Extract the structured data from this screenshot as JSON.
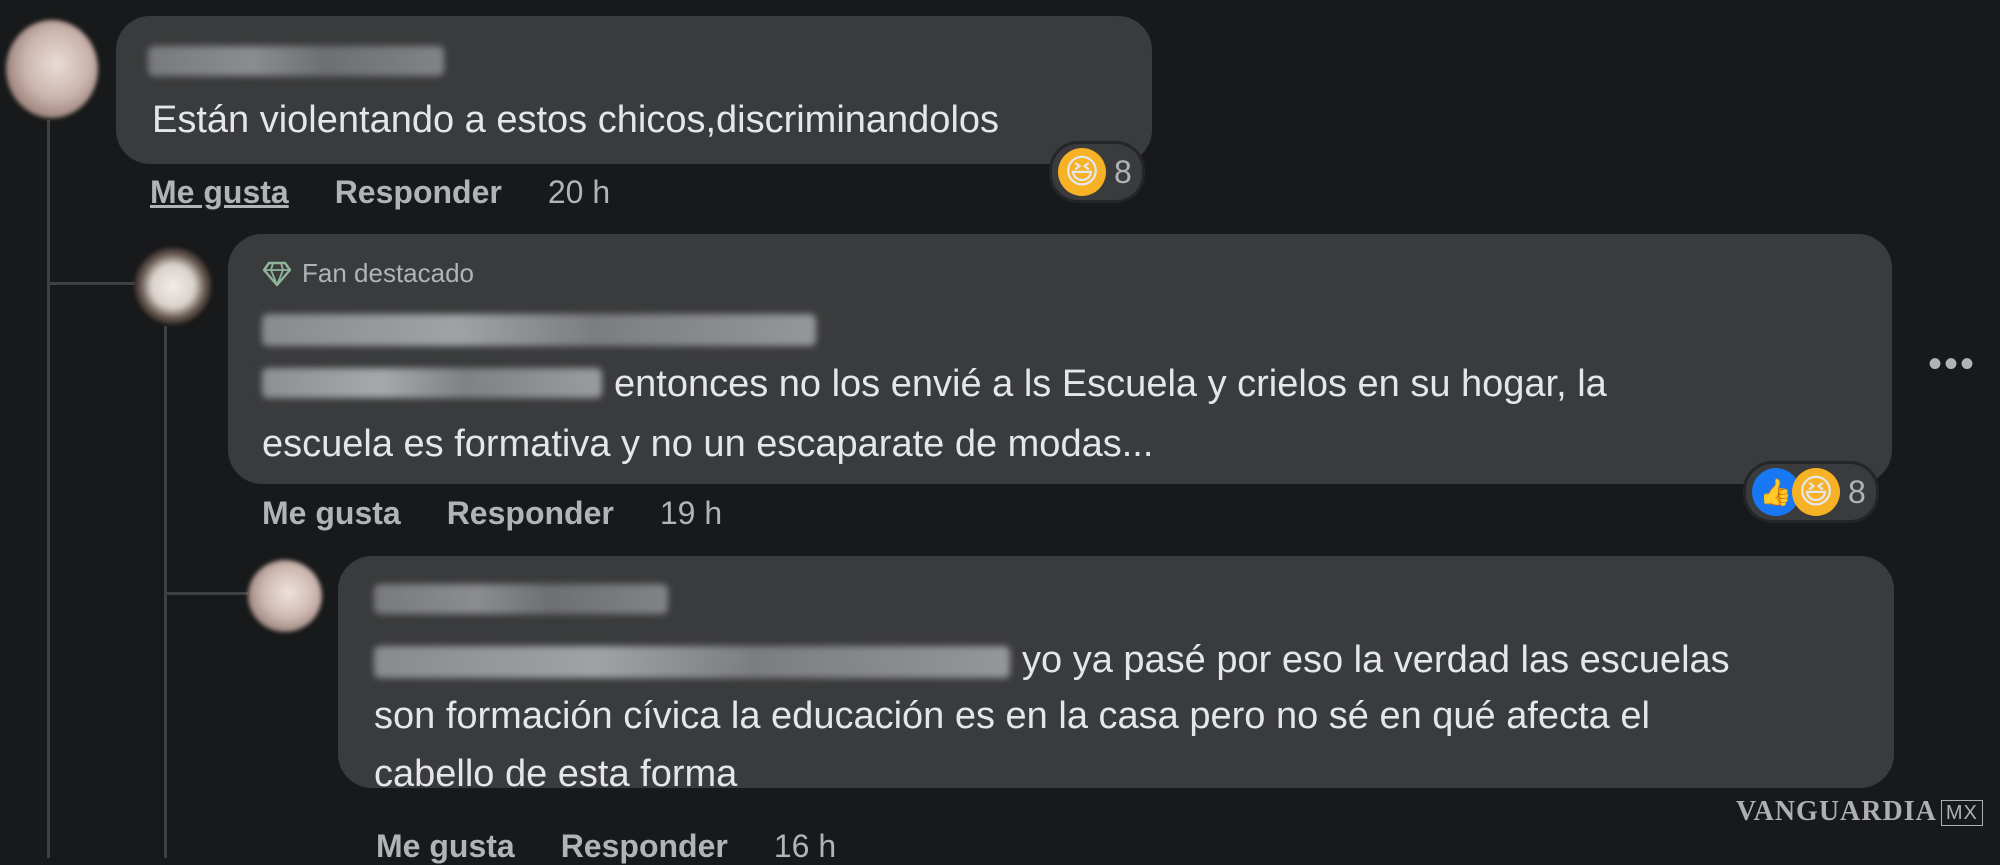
{
  "thread": {
    "comments": [
      {
        "text": "Están violentando a estos chicos,discriminandolos",
        "actions": {
          "like": "Me gusta",
          "reply": "Responder",
          "time": "20 h"
        },
        "reactions": {
          "icons": [
            "haha-icon"
          ],
          "count": "8"
        }
      },
      {
        "badge": "Fan destacado",
        "text_line1": "entonces no los envié a ls Escuela y crielos en su hogar, la",
        "text_line2": "escuela es formativa y no un escaparate de modas...",
        "actions": {
          "like": "Me gusta",
          "reply": "Responder",
          "time": "19 h"
        },
        "reactions": {
          "icons": [
            "like-icon",
            "haha-icon"
          ],
          "count": "8"
        }
      },
      {
        "text_line1": "yo ya pasé por eso la verdad las escuelas",
        "text_line2": "son formación cívica la educación es en la casa pero no sé en qué afecta el",
        "text_line3": "cabello de esta forma",
        "actions": {
          "like": "Me gusta",
          "reply": "Responder",
          "time": "16 h"
        }
      }
    ],
    "more_options": "•••"
  },
  "watermark": {
    "brand": "VANGUARDIA",
    "suffix": "MX"
  },
  "colors": {
    "background": "#18191a",
    "bubble": "#3a3b3c",
    "text": "#e4e6eb",
    "secondary_text": "#b0b3b8",
    "haha": "#f7b125",
    "like": "#1877f2"
  }
}
